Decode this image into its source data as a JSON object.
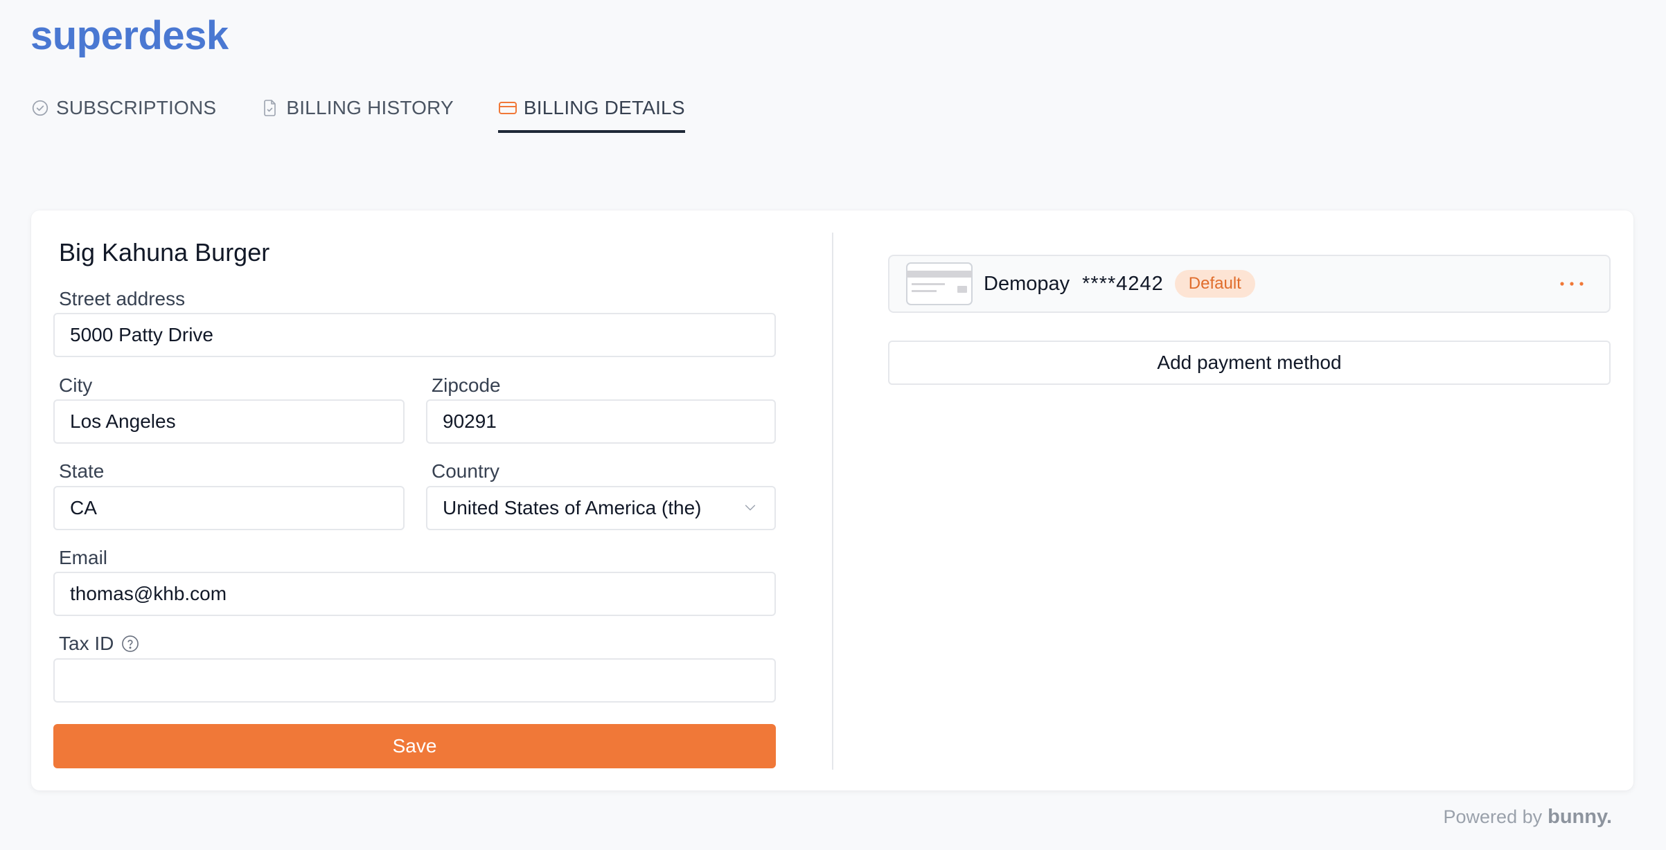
{
  "brand": {
    "logo_text": "superdesk",
    "color": "#4a78d2"
  },
  "tabs": [
    {
      "label": "SUBSCRIPTIONS",
      "icon": "check-circle-icon",
      "active": false
    },
    {
      "label": "BILLING HISTORY",
      "icon": "document-icon",
      "active": false
    },
    {
      "label": "BILLING DETAILS",
      "icon": "credit-card-icon",
      "active": true
    }
  ],
  "form": {
    "company_name": "Big Kahuna Burger",
    "street": {
      "label": "Street address",
      "value": "5000 Patty Drive"
    },
    "city": {
      "label": "City",
      "value": "Los Angeles"
    },
    "zipcode": {
      "label": "Zipcode",
      "value": "90291"
    },
    "state": {
      "label": "State",
      "value": "CA"
    },
    "country": {
      "label": "Country",
      "value": "United States of America (the)"
    },
    "email": {
      "label": "Email",
      "value": "thomas@khb.com"
    },
    "tax_id": {
      "label": "Tax ID",
      "value": ""
    },
    "save_label": "Save"
  },
  "payment": {
    "method": {
      "brand": "Demopay",
      "last4": "****4242",
      "badge": "Default"
    },
    "add_label": "Add payment method"
  },
  "footer": {
    "powered_by": "Powered by",
    "brand": "bunny."
  },
  "colors": {
    "accent": "#f07838",
    "badge_bg": "#fde4d4",
    "badge_text": "#e06d2c"
  }
}
